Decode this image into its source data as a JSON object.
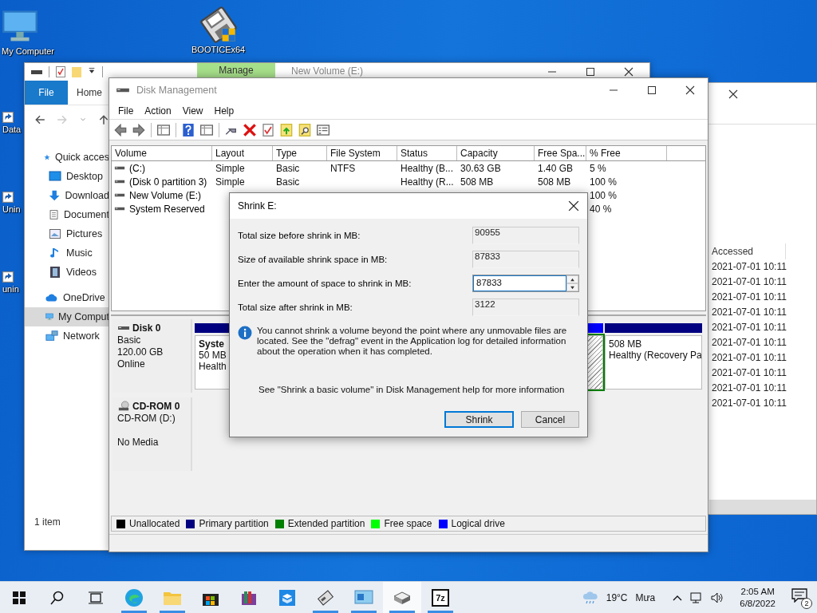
{
  "desktop_icons": [
    {
      "label": "My Computer",
      "kind": "computer"
    },
    {
      "label": "BOOTICEx64",
      "kind": "floppy"
    },
    {
      "label": "Data",
      "kind": "shortcut"
    },
    {
      "label": "Unin",
      "kind": "shortcut"
    },
    {
      "label": "unin",
      "kind": "shortcut"
    }
  ],
  "back_window": {
    "column": "Accessed",
    "rows": [
      "2021-07-01 10:11",
      "2021-07-01 10:11",
      "2021-07-01 10:11",
      "2021-07-01 10:11",
      "2021-07-01 10:11",
      "2021-07-01 10:11",
      "2021-07-01 10:11",
      "2021-07-01 10:11",
      "2021-07-01 10:11",
      "2021-07-01 10:11"
    ]
  },
  "explorer": {
    "contextual_tab": "Manage",
    "title": "New Volume (E:)",
    "ribbon_tabs": [
      {
        "label": "File",
        "selected": true
      },
      {
        "label": "Home",
        "selected": false
      }
    ],
    "nav_items": [
      {
        "label": "Quick acces",
        "kind": "star",
        "selected": false
      },
      {
        "label": "Desktop",
        "kind": "desktop",
        "selected": false
      },
      {
        "label": "Download",
        "kind": "download",
        "selected": false
      },
      {
        "label": "Document",
        "kind": "document",
        "selected": false
      },
      {
        "label": "Pictures",
        "kind": "pictures",
        "selected": false
      },
      {
        "label": "Music",
        "kind": "music",
        "selected": false
      },
      {
        "label": "Videos",
        "kind": "videos",
        "selected": false
      },
      {
        "label": "OneDrive",
        "kind": "cloud",
        "selected": false
      },
      {
        "label": "My Comput",
        "kind": "computer",
        "selected": true
      },
      {
        "label": "Network",
        "kind": "network",
        "selected": false
      }
    ],
    "status_bar": "1 item"
  },
  "disk_management": {
    "title": "Disk Management",
    "menu": [
      "File",
      "Action",
      "View",
      "Help"
    ],
    "columns": [
      "Volume",
      "Layout",
      "Type",
      "File System",
      "Status",
      "Capacity",
      "Free Spa...",
      "% Free"
    ],
    "rows": [
      {
        "cells": [
          "(C:)",
          "Simple",
          "Basic",
          "NTFS",
          "Healthy (B...",
          "30.63 GB",
          "1.40 GB",
          "5 %"
        ]
      },
      {
        "cells": [
          "(Disk 0 partition 3)",
          "Simple",
          "Basic",
          null,
          "Healthy (R...",
          "508 MB",
          "508 MB",
          "100 %"
        ]
      },
      {
        "cells": [
          "New Volume (E:)",
          null,
          null,
          null,
          null,
          null,
          null,
          "100 %"
        ]
      },
      {
        "cells": [
          "System Reserved",
          null,
          null,
          null,
          null,
          null,
          null,
          "40 %"
        ]
      }
    ],
    "disks": [
      {
        "name": "Disk 0",
        "kind": "disk",
        "lines": [
          "Basic",
          "120.00 GB",
          "Online"
        ],
        "partitions": [
          {
            "kind": "primary",
            "selected": false,
            "title": "Syste",
            "lines": [
              "50 MB",
              "Health"
            ]
          },
          {
            "kind": "logical",
            "selected": true
          },
          {
            "kind": "primary",
            "selected": false,
            "lines": [
              "508 MB",
              "Healthy (Recovery Pa"
            ]
          }
        ]
      },
      {
        "name": "CD-ROM 0",
        "kind": "cdrom",
        "lines": [
          "CD-ROM (D:)",
          "No Media"
        ]
      }
    ],
    "legend": [
      {
        "label": "Unallocated",
        "color": "#000000"
      },
      {
        "label": "Primary partition",
        "color": "#000080"
      },
      {
        "label": "Extended partition",
        "color": "#008000"
      },
      {
        "label": "Free space",
        "color": "#00ff00"
      },
      {
        "label": "Logical drive",
        "color": "#0000ff"
      }
    ]
  },
  "dialog": {
    "title": "Shrink E:",
    "fields": [
      {
        "label": "Total size before shrink in MB:",
        "value": "90955",
        "kind": "readonly"
      },
      {
        "label": "Size of available shrink space in MB:",
        "value": "87833",
        "kind": "readonly"
      },
      {
        "label": "Enter the amount of space to shrink in MB:",
        "value": "87833",
        "kind": "spinner"
      },
      {
        "label": "Total size after shrink in MB:",
        "value": "3122",
        "kind": "readonly"
      }
    ],
    "info": "You cannot shrink a volume beyond the point where any unmovable files are located. See the \"defrag\" event in the Application log for detailed information about the operation when it has completed.",
    "help": "See \"Shrink a basic volume\" in Disk Management help for more information",
    "buttons": [
      {
        "label": "Shrink",
        "default": true
      },
      {
        "label": "Cancel",
        "default": false
      }
    ]
  },
  "taskbar": {
    "apps": [
      {
        "kind": "edge",
        "running": true,
        "selected": false
      },
      {
        "kind": "folder",
        "running": true,
        "selected": false
      },
      {
        "kind": "store",
        "running": false,
        "selected": false
      },
      {
        "kind": "archive",
        "running": false,
        "selected": false
      },
      {
        "kind": "box",
        "running": false,
        "selected": false
      },
      {
        "kind": "drive",
        "running": true,
        "selected": false
      },
      {
        "kind": "screen",
        "running": true,
        "selected": false
      },
      {
        "kind": "floppy",
        "running": true,
        "selected": true
      },
      {
        "kind": "sevenzip",
        "label": "7z",
        "running": true,
        "selected": false
      }
    ],
    "temperature": "19°C",
    "weather": "Mưa",
    "time": "2:05 AM",
    "date": "6/8/2022",
    "notifications": "2"
  }
}
